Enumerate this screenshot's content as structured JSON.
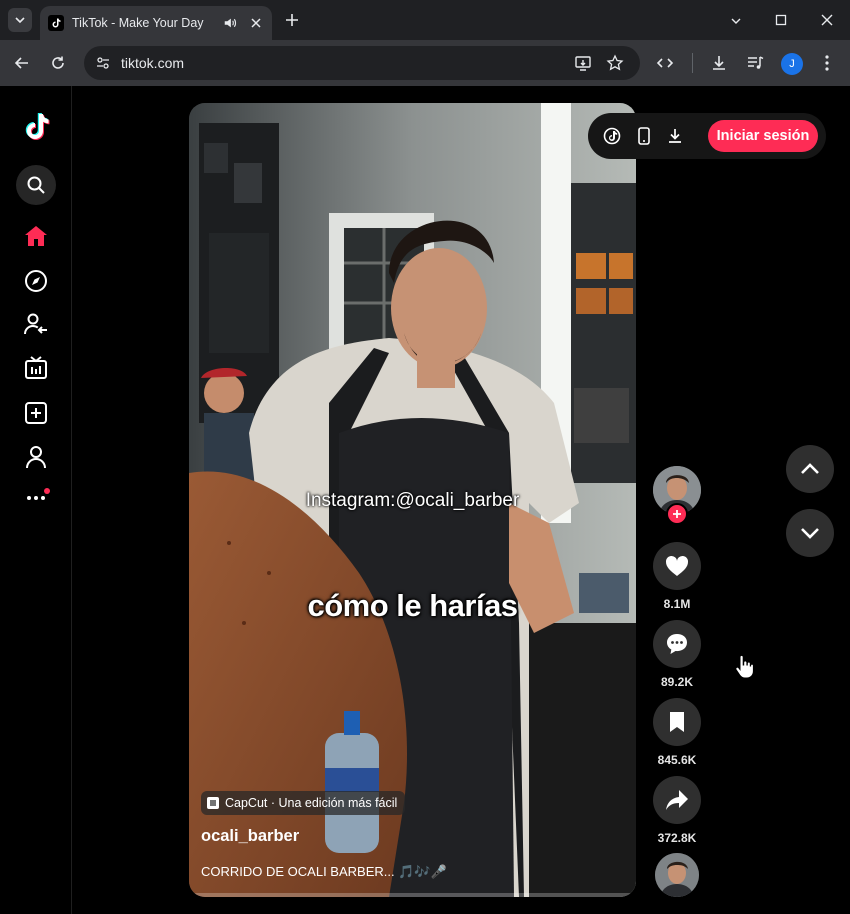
{
  "browser": {
    "tab_title": "TikTok - Make Your Day",
    "url": "tiktok.com",
    "profile_initial": "J",
    "icons": [
      "tab-search-icon",
      "tiktok-favicon",
      "audio-icon",
      "close-icon",
      "new-tab-icon",
      "minimize-icon",
      "maximize-icon",
      "window-close-icon",
      "back-icon",
      "reload-icon",
      "site-info-icon",
      "install-app-icon",
      "bookmark-star-icon",
      "devtools-icon",
      "download-icon",
      "media-control-icon",
      "menu-icon"
    ]
  },
  "sidenav": {
    "items": [
      {
        "name": "tiktok-logo",
        "icon": "tiktok-logo-icon"
      },
      {
        "name": "search",
        "icon": "search-icon"
      },
      {
        "name": "for-you",
        "icon": "home-icon",
        "active": true
      },
      {
        "name": "explore",
        "icon": "compass-icon"
      },
      {
        "name": "following",
        "icon": "user-follow-icon"
      },
      {
        "name": "live",
        "icon": "live-tv-icon"
      },
      {
        "name": "upload",
        "icon": "plus-square-icon"
      },
      {
        "name": "profile",
        "icon": "user-icon"
      },
      {
        "name": "more",
        "icon": "more-dots-icon"
      }
    ],
    "accent": "#fe2c55"
  },
  "video": {
    "overlay_instagram": "Instagram:@ocali_barber",
    "overlay_caption": "cómo le harías",
    "capcut_label": "CapCut · Una edición más fácil",
    "author": "ocali_barber",
    "description": "CORRIDO DE OCALI BARBER... 🎵🎶🎤",
    "progress": 0.0
  },
  "top_actions": {
    "login_label": "Iniciar sesión",
    "icons": [
      "tiktok-coin-icon",
      "phone-icon",
      "download-icon"
    ]
  },
  "rail": {
    "likes": "8.1M",
    "comments": "89.2K",
    "saves": "845.6K",
    "shares": "372.8K",
    "icons": [
      "heart-icon",
      "comment-icon",
      "bookmark-icon",
      "share-icon"
    ]
  }
}
